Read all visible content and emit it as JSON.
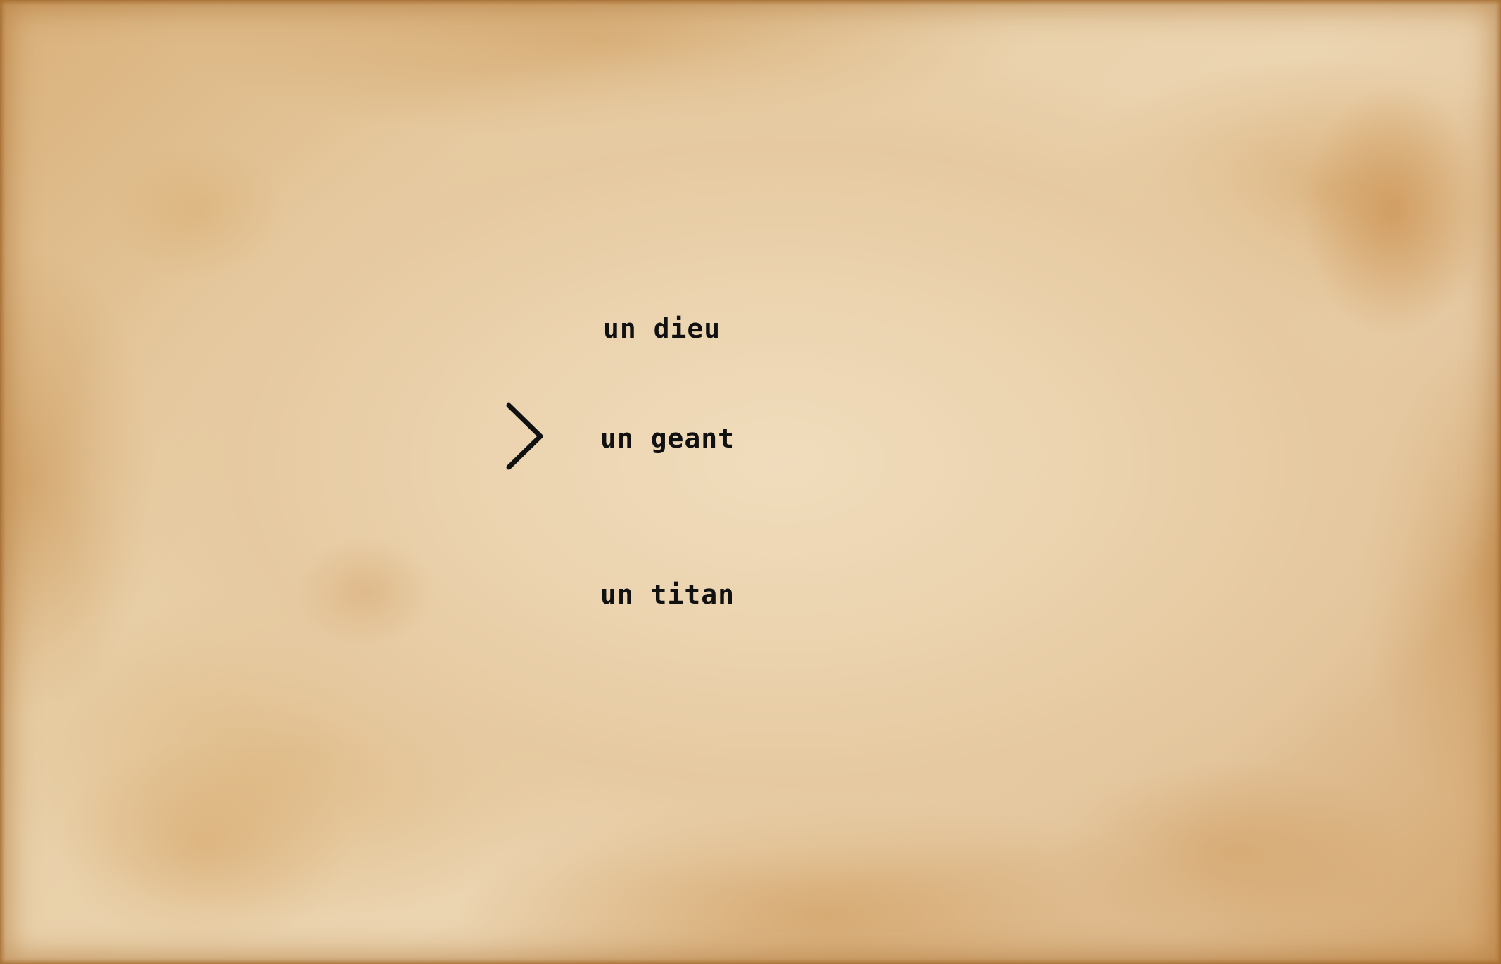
{
  "menu": {
    "options": [
      {
        "label": "un dieu"
      },
      {
        "label": "un geant"
      },
      {
        "label": "un titan"
      }
    ],
    "selected_index": 1
  },
  "icons": {
    "cursor": "chevron-right-icon"
  },
  "colors": {
    "text": "#111111",
    "paper": "#ebd3ae",
    "stain": "#c9914e"
  }
}
